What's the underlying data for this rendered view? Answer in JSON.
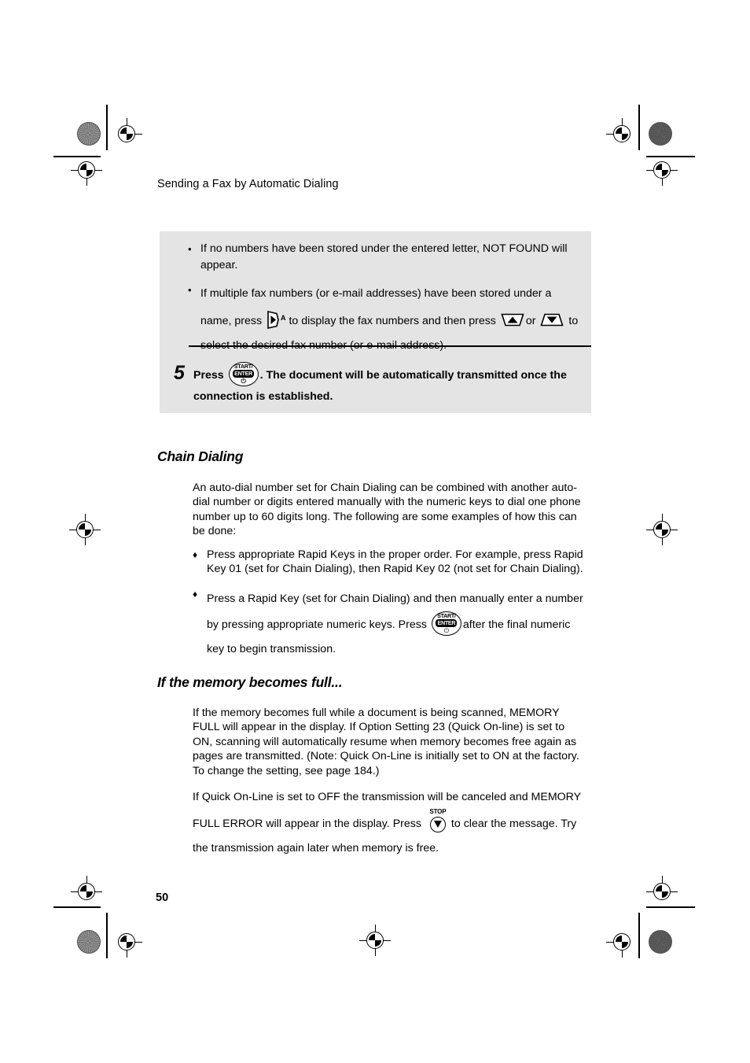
{
  "page": {
    "running_head": "Sending a Fax by Automatic Dialing",
    "page_number": "50"
  },
  "notice_box": {
    "bullets": [
      {
        "marker": "•",
        "text": "If no numbers have been stored under the entered letter, NOT FOUND will appear."
      },
      {
        "marker": "•",
        "part1": "If multiple fax numbers (or e-mail addresses) have been stored under a name, press",
        "key1": "right-arrow-key",
        "key1_sup": "A",
        "part2": "to display the fax numbers and then press",
        "key2": "up-arrow-key",
        "conjunction": "or",
        "key3": "down-arrow-key",
        "part3": "to select the desired fax number (or e-mail address)."
      }
    ],
    "step": {
      "number": "5",
      "text_before_key": "Press",
      "key": "start-enter-key",
      "key_label_top": "START/",
      "key_label_bottom": "ENTER",
      "key_power_glyph": "⏻",
      "text_after_key": ". The document will be automatically transmitted once the connection is established."
    }
  },
  "sections": [
    {
      "heading": "Chain Dialing",
      "paragraph": "An auto-dial number set for Chain Dialing can be combined with another auto-dial number or digits entered manually with the numeric keys to dial one phone number up to 60 digits long. The following are some examples of how this can be done:",
      "items": [
        {
          "marker": "♦",
          "text": "Press appropriate Rapid Keys in the proper order. For example, press Rapid Key 01 (set for Chain Dialing), then Rapid Key 02 (not set for Chain Dialing)."
        },
        {
          "marker": "♦",
          "text_before_key": "Press a Rapid Key (set for Chain Dialing) and then manually enter a number by pressing appropriate numeric keys. Press",
          "key": "start-enter-key",
          "text_after_key": "after the final numeric key to begin transmission."
        }
      ]
    },
    {
      "heading": "If the memory becomes full...",
      "paragraph1": "If the memory becomes full while a document is being scanned, MEMORY FULL will appear in the display. If Option Setting 23 (Quick On-line) is set to ON, scanning will automatically resume when memory becomes free again as pages are transmitted. (Note: Quick On-Line is initially set to ON at the factory. To change the setting, see page 184.)",
      "paragraph2_before_key": "If Quick On-Line is set to OFF the transmission will be canceled and MEMORY FULL ERROR will appear in the display. Press",
      "key": "stop-key",
      "key_label": "STOP",
      "paragraph2_after_key": "to clear the message. Try the transmission again later when memory is free."
    }
  ],
  "colors": {
    "notice_box_background": "#e4e4e4",
    "text": "#000000",
    "page_background": "#ffffff"
  }
}
